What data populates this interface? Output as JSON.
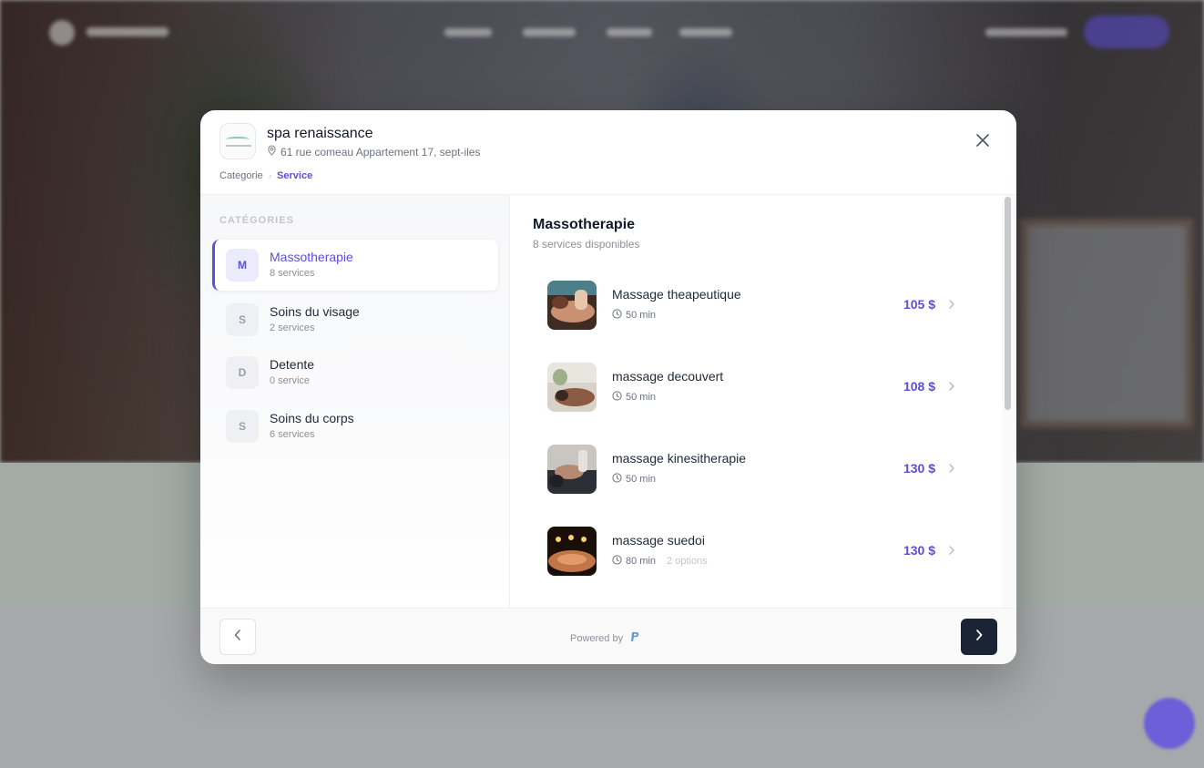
{
  "business": {
    "name": "spa renaissance",
    "address": "61 rue comeau Appartement 17, sept-iles"
  },
  "breadcrumb": [
    {
      "label": "Categorie"
    },
    {
      "label": "Service"
    }
  ],
  "sidebar": {
    "heading": "CATÉGORIES",
    "categories": [
      {
        "initial": "M",
        "label": "Massotherapie",
        "count": "8 services"
      },
      {
        "initial": "S",
        "label": "Soins du visage",
        "count": "2 services"
      },
      {
        "initial": "D",
        "label": "Detente",
        "count": "0 service"
      },
      {
        "initial": "S",
        "label": "Soins du corps",
        "count": "6 services"
      }
    ]
  },
  "main": {
    "title": "Massotherapie",
    "subtitle": "8 services disponibles",
    "services": [
      {
        "name": "Massage theapeutique",
        "duration": "50 min",
        "options": "",
        "price": "105 $"
      },
      {
        "name": "massage decouvert",
        "duration": "50 min",
        "options": "",
        "price": "108 $"
      },
      {
        "name": "massage kinesitherapie",
        "duration": "50 min",
        "options": "",
        "price": "130 $"
      },
      {
        "name": "massage suedoi",
        "duration": "80 min",
        "options": "2 options",
        "price": "130 $"
      }
    ]
  },
  "footer": {
    "powered_by": "Powered by"
  },
  "colors": {
    "accent": "#5b4fd8",
    "dark_button": "#1b2434"
  }
}
